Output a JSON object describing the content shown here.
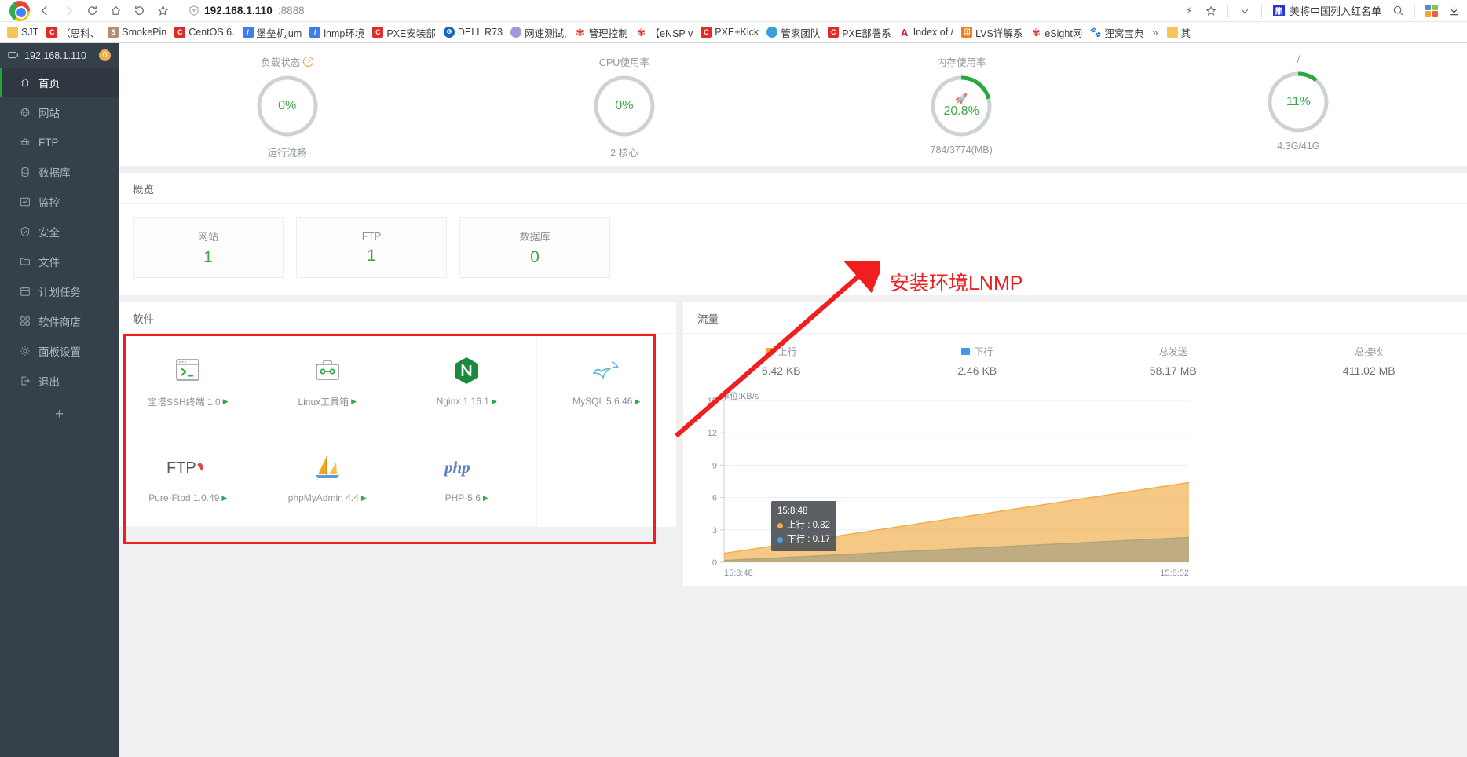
{
  "browser": {
    "url_host": "192.168.1.110",
    "url_port": ":8888",
    "nav": {
      "back": "back-arrow",
      "forward": "forward-arrow",
      "reload": "reload",
      "home": "home",
      "history": "history-back",
      "bookmark": "star"
    },
    "search_pill": "美将中国列入红名单",
    "bookmarks": [
      {
        "label": "SJT",
        "icon": "folder",
        "color": "#f3c55a",
        "letter": ""
      },
      {
        "label": "（思科、",
        "icon": "letter",
        "color": "#e02b28",
        "letter": "C"
      },
      {
        "label": "SmokePin",
        "icon": "letter",
        "color": "#b09070",
        "letter": "S"
      },
      {
        "label": "CentOS 6.",
        "icon": "letter",
        "color": "#e02b28",
        "letter": "C"
      },
      {
        "label": "堡垒机jum",
        "icon": "letter",
        "color": "#3d7ee8",
        "letter": "/"
      },
      {
        "label": "lnmp环境",
        "icon": "letter",
        "color": "#3d7ee8",
        "letter": "/"
      },
      {
        "label": "PXE安装部",
        "icon": "letter",
        "color": "#e02b28",
        "letter": "C"
      },
      {
        "label": "DELL R73",
        "icon": "circle",
        "color": "#1565c0",
        "letter": "❶"
      },
      {
        "label": "网速测试,",
        "icon": "circle",
        "color": "#9b9bd8",
        "letter": ""
      },
      {
        "label": "管理控制",
        "icon": "huawei",
        "color": "#e02b28",
        "letter": ""
      },
      {
        "label": "【eNSP v",
        "icon": "huawei",
        "color": "#e02b28",
        "letter": ""
      },
      {
        "label": "PXE+Kick",
        "icon": "letter",
        "color": "#e02b28",
        "letter": "C"
      },
      {
        "label": "管家团队",
        "icon": "circle",
        "color": "#3aa0dc",
        "letter": ""
      },
      {
        "label": "PXE部署系",
        "icon": "letter",
        "color": "#e02b28",
        "letter": "C"
      },
      {
        "label": "Index of /",
        "icon": "letter-a",
        "color": "#ffffff",
        "letter": "A"
      },
      {
        "label": "LVS详解系",
        "icon": "letter",
        "color": "#f07c25",
        "letter": "印"
      },
      {
        "label": "eSight网",
        "icon": "huawei",
        "color": "#e02b28",
        "letter": ""
      },
      {
        "label": "狸窝宝典",
        "icon": "paw",
        "color": "#c49a6c",
        "letter": ""
      }
    ],
    "bookmarks_overflow": "»",
    "bookmarks_tail": "其"
  },
  "sidebar": {
    "host": "192.168.1.110",
    "badge": "0",
    "items": [
      {
        "label": "首页",
        "icon": "home-icon",
        "active": true
      },
      {
        "label": "网站",
        "icon": "globe-icon",
        "active": false
      },
      {
        "label": "FTP",
        "icon": "ftp-icon",
        "active": false
      },
      {
        "label": "数据库",
        "icon": "database-icon",
        "active": false
      },
      {
        "label": "监控",
        "icon": "monitor-icon",
        "active": false
      },
      {
        "label": "安全",
        "icon": "shield-icon",
        "active": false
      },
      {
        "label": "文件",
        "icon": "folder-icon",
        "active": false
      },
      {
        "label": "计划任务",
        "icon": "calendar-icon",
        "active": false
      },
      {
        "label": "软件商店",
        "icon": "apps-icon",
        "active": false
      },
      {
        "label": "面板设置",
        "icon": "gear-icon",
        "active": false
      },
      {
        "label": "退出",
        "icon": "logout-icon",
        "active": false
      }
    ],
    "add_label": "+"
  },
  "gauges": [
    {
      "title": "负载状态",
      "help": "?",
      "value": "0%",
      "percent": 0,
      "sub": "运行流畅",
      "rocket": false
    },
    {
      "title": "CPU使用率",
      "help": "",
      "value": "0%",
      "percent": 0,
      "sub": "2 核心",
      "rocket": false
    },
    {
      "title": "内存使用率",
      "help": "",
      "value": "20.8%",
      "percent": 20.8,
      "sub": "784/3774(MB)",
      "rocket": true
    },
    {
      "title": "/",
      "help": "",
      "value": "11%",
      "percent": 11,
      "sub": "4.3G/41G",
      "rocket": false
    }
  ],
  "overview": {
    "title": "概览",
    "tiles": [
      {
        "label": "网站",
        "value": "1"
      },
      {
        "label": "FTP",
        "value": "1"
      },
      {
        "label": "数据库",
        "value": "0"
      }
    ]
  },
  "software": {
    "title": "软件",
    "items": [
      {
        "name": "宝塔SSH终端 1.0",
        "icon": "terminal-icon"
      },
      {
        "name": "Linux工具箱",
        "icon": "toolbox-icon"
      },
      {
        "name": "Nginx 1.16.1",
        "icon": "nginx-icon"
      },
      {
        "name": "MySQL 5.6.46",
        "icon": "mysql-dolphin-icon"
      },
      {
        "name": "Pure-Ftpd 1.0.49",
        "icon": "ftp-logo-icon"
      },
      {
        "name": "phpMyAdmin 4.4",
        "icon": "phpmyadmin-icon"
      },
      {
        "name": "PHP-5.6",
        "icon": "php-icon"
      }
    ]
  },
  "traffic": {
    "title": "流量",
    "stats": [
      {
        "label": "上行",
        "value": "6.42 KB",
        "color": "#efa73c",
        "swatch": true
      },
      {
        "label": "下行",
        "value": "2.46 KB",
        "color": "#3c9ae8",
        "swatch": true
      },
      {
        "label": "总发送",
        "value": "58.17 MB",
        "color": "",
        "swatch": false
      },
      {
        "label": "总接收",
        "value": "411.02 MB",
        "color": "",
        "swatch": false
      }
    ],
    "tooltip": {
      "time": "15:8:48",
      "rows": [
        {
          "label": "上行 : 0.82",
          "color": "#efa73c"
        },
        {
          "label": "下行 : 0.17",
          "color": "#3c9ae8"
        }
      ]
    }
  },
  "chart_data": {
    "type": "area",
    "title": "流量",
    "unit_label": "单位:KB/s",
    "xlabel": "",
    "ylabel": "KB/s",
    "ylim": [
      0,
      15
    ],
    "yticks": [
      0,
      3,
      6,
      9,
      12,
      15
    ],
    "grid": true,
    "legend_position": "top",
    "x": [
      "15:8:48",
      "15:8:52"
    ],
    "xticks": [
      "15:8:48",
      "15:8:52"
    ],
    "series": [
      {
        "name": "上行",
        "color": "#efa73c",
        "values": [
          0.82,
          7.4
        ]
      },
      {
        "name": "下行",
        "color": "#3c9ae8",
        "values": [
          0.17,
          2.3
        ]
      }
    ]
  },
  "annotations": {
    "callout_text": "安装环境LNMP",
    "callout_color": "#f01e1e",
    "box_color": "#f01e1e"
  }
}
